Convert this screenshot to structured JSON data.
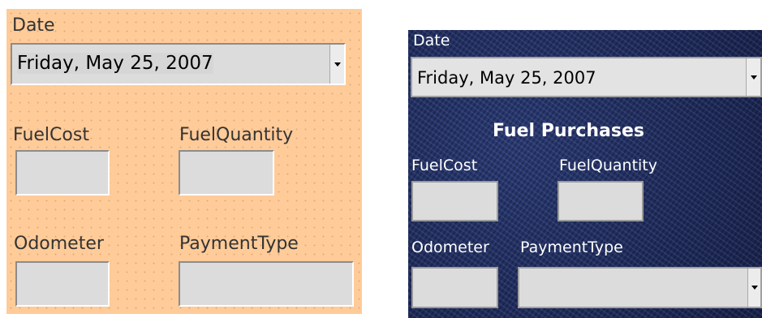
{
  "design_form": {
    "date_label": "Date",
    "date_value": "Friday, May 25, 2007",
    "fuelcost_label": "FuelCost",
    "fuelquantity_label": "FuelQuantity",
    "odometer_label": "Odometer",
    "paymenttype_label": "PaymentType",
    "background_color": "#ffcb99"
  },
  "runtime_form": {
    "date_label": "Date",
    "date_value": "Friday, May 25, 2007",
    "title": "Fuel Purchases",
    "fuelcost_label": "FuelCost",
    "fuelquantity_label": "FuelQuantity",
    "odometer_label": "Odometer",
    "paymenttype_label": "PaymentType",
    "background_color": "#1e2c5c"
  },
  "icons": {
    "dropdown": "chevron-down-icon"
  }
}
